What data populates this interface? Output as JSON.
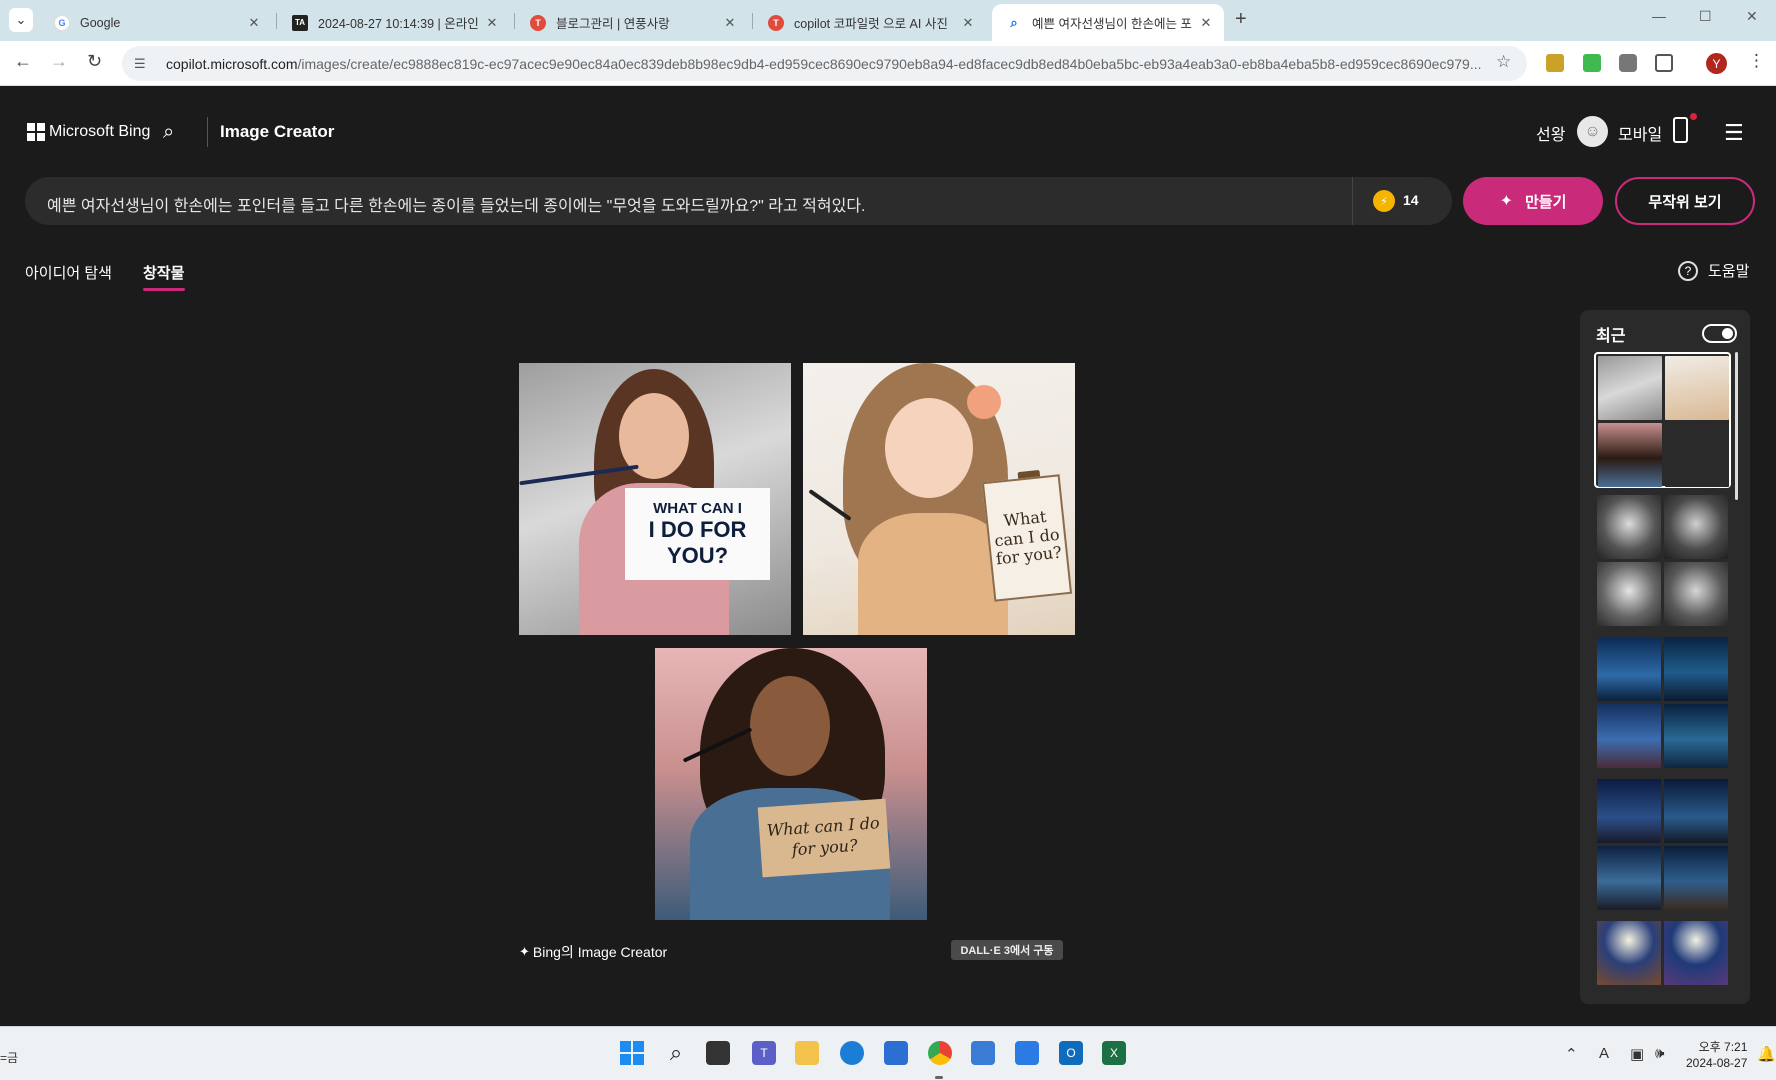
{
  "browser": {
    "tabs": [
      {
        "label": "Google",
        "active": false
      },
      {
        "label": "2024-08-27 10:14:39 | 온라인",
        "active": false
      },
      {
        "label": "블로그관리 | 연풍사랑",
        "active": false
      },
      {
        "label": "copilot 코파일럿 으로 AI 사진",
        "active": false
      },
      {
        "label": "예쁜 여자선생님이 한손에는 포",
        "active": true
      }
    ],
    "url_host": "copilot.microsoft.com",
    "url_path": "/images/create/ec9888ec819c-ec97acec9e90ec84a0ec839deb8b98ec9db4-ed959cec8690ec9790eb8a94-ed8facec9db8ed84b0eba5bc-eb93a4eab3a0-eb8ba4eba5b8-ed959cec8690ec979...",
    "profile_initial": "Y"
  },
  "header": {
    "brand": "Microsoft Bing",
    "title": "Image Creator",
    "user_name": "선왕",
    "mobile_label": "모바일"
  },
  "prompt": {
    "text": "예쁜 여자선생님이 한손에는 포인터를 들고 다른 한손에는 종이를 들었는데 종이에는 \"무엇을 도와드릴까요?\" 라고 적혀있다.",
    "coins": "14",
    "create_label": "만들기",
    "random_label": "무작위 보기"
  },
  "tabs": {
    "explore": "아이디어 탐색",
    "creations": "창작물",
    "help": "도움말"
  },
  "images": [
    {
      "sign_l1": "WHAT CAN I",
      "sign_l2": "I DO FOR YOU?"
    },
    {
      "sign": "What can I do for you?"
    },
    {
      "sign": "What can I do for you?"
    }
  ],
  "footer": {
    "caption": "Bing의 Image Creator",
    "badge": "DALL·E 3에서 구동"
  },
  "side": {
    "title": "최근"
  },
  "taskbar": {
    "left_text": "=금",
    "time": "오후 7:21",
    "date": "2024-08-27"
  }
}
